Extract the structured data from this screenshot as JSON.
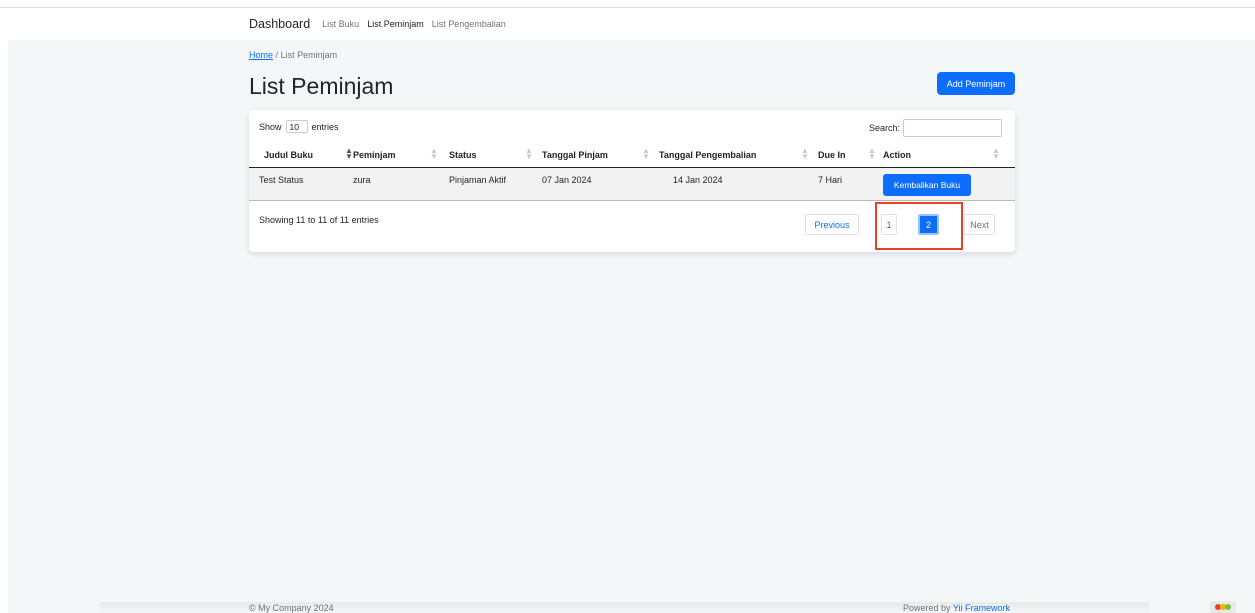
{
  "nav": {
    "brand": "Dashboard",
    "links": [
      "List Buku",
      "List Peminjam",
      "List Pengembalian"
    ]
  },
  "breadcrumb": {
    "home": "Home",
    "separator": "/",
    "current": "List Peminjam"
  },
  "page": {
    "title": "List Peminjam",
    "add_button": "Add Peminjam"
  },
  "table": {
    "length": {
      "prefix": "Show",
      "value": "10",
      "suffix": "entries"
    },
    "search_label": "Search:",
    "search_value": "",
    "columns": [
      "Judul Buku",
      "Peminjam",
      "Status",
      "Tanggal Pinjam",
      "Tanggal Pengembalian",
      "Due In",
      "Action"
    ],
    "rows": [
      {
        "judul_buku": "Test Status",
        "peminjam": "zura",
        "status": "Pinjaman Aktif",
        "tanggal_pinjam": "07 Jan 2024",
        "tanggal_pengembalian": "14 Jan 2024",
        "due_in": "7 Hari",
        "action": "Kembalikan Buku"
      }
    ],
    "info": "Showing 11 to 11 of 11 entries",
    "pagination": {
      "previous": "Previous",
      "pages": [
        "1",
        "2"
      ],
      "current": "2",
      "next": "Next"
    }
  },
  "footer": {
    "left": "© My Company 2024",
    "right_prefix": "Powered by",
    "right_link": "Yii Framework"
  },
  "colors": {
    "primary": "#0d6efd",
    "highlight": "#e8402a",
    "background": "#f4f7f8"
  }
}
